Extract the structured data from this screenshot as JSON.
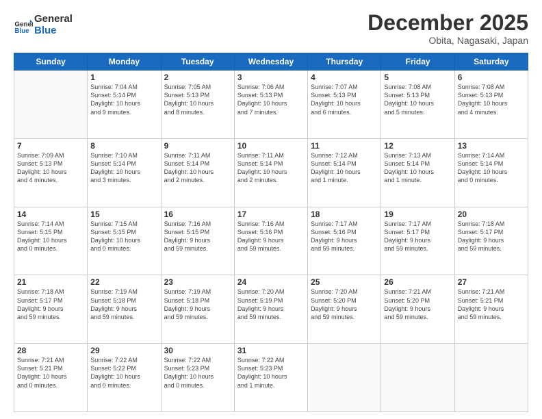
{
  "header": {
    "logo_text_general": "General",
    "logo_text_blue": "Blue",
    "month": "December 2025",
    "location": "Obita, Nagasaki, Japan"
  },
  "days_of_week": [
    "Sunday",
    "Monday",
    "Tuesday",
    "Wednesday",
    "Thursday",
    "Friday",
    "Saturday"
  ],
  "weeks": [
    [
      {
        "day": "",
        "info": ""
      },
      {
        "day": "1",
        "info": "Sunrise: 7:04 AM\nSunset: 5:14 PM\nDaylight: 10 hours\nand 9 minutes."
      },
      {
        "day": "2",
        "info": "Sunrise: 7:05 AM\nSunset: 5:13 PM\nDaylight: 10 hours\nand 8 minutes."
      },
      {
        "day": "3",
        "info": "Sunrise: 7:06 AM\nSunset: 5:13 PM\nDaylight: 10 hours\nand 7 minutes."
      },
      {
        "day": "4",
        "info": "Sunrise: 7:07 AM\nSunset: 5:13 PM\nDaylight: 10 hours\nand 6 minutes."
      },
      {
        "day": "5",
        "info": "Sunrise: 7:08 AM\nSunset: 5:13 PM\nDaylight: 10 hours\nand 5 minutes."
      },
      {
        "day": "6",
        "info": "Sunrise: 7:08 AM\nSunset: 5:13 PM\nDaylight: 10 hours\nand 4 minutes."
      }
    ],
    [
      {
        "day": "7",
        "info": "Sunrise: 7:09 AM\nSunset: 5:13 PM\nDaylight: 10 hours\nand 4 minutes."
      },
      {
        "day": "8",
        "info": "Sunrise: 7:10 AM\nSunset: 5:14 PM\nDaylight: 10 hours\nand 3 minutes."
      },
      {
        "day": "9",
        "info": "Sunrise: 7:11 AM\nSunset: 5:14 PM\nDaylight: 10 hours\nand 2 minutes."
      },
      {
        "day": "10",
        "info": "Sunrise: 7:11 AM\nSunset: 5:14 PM\nDaylight: 10 hours\nand 2 minutes."
      },
      {
        "day": "11",
        "info": "Sunrise: 7:12 AM\nSunset: 5:14 PM\nDaylight: 10 hours\nand 1 minute."
      },
      {
        "day": "12",
        "info": "Sunrise: 7:13 AM\nSunset: 5:14 PM\nDaylight: 10 hours\nand 1 minute."
      },
      {
        "day": "13",
        "info": "Sunrise: 7:14 AM\nSunset: 5:14 PM\nDaylight: 10 hours\nand 0 minutes."
      }
    ],
    [
      {
        "day": "14",
        "info": "Sunrise: 7:14 AM\nSunset: 5:15 PM\nDaylight: 10 hours\nand 0 minutes."
      },
      {
        "day": "15",
        "info": "Sunrise: 7:15 AM\nSunset: 5:15 PM\nDaylight: 10 hours\nand 0 minutes."
      },
      {
        "day": "16",
        "info": "Sunrise: 7:16 AM\nSunset: 5:15 PM\nDaylight: 9 hours\nand 59 minutes."
      },
      {
        "day": "17",
        "info": "Sunrise: 7:16 AM\nSunset: 5:16 PM\nDaylight: 9 hours\nand 59 minutes."
      },
      {
        "day": "18",
        "info": "Sunrise: 7:17 AM\nSunset: 5:16 PM\nDaylight: 9 hours\nand 59 minutes."
      },
      {
        "day": "19",
        "info": "Sunrise: 7:17 AM\nSunset: 5:17 PM\nDaylight: 9 hours\nand 59 minutes."
      },
      {
        "day": "20",
        "info": "Sunrise: 7:18 AM\nSunset: 5:17 PM\nDaylight: 9 hours\nand 59 minutes."
      }
    ],
    [
      {
        "day": "21",
        "info": "Sunrise: 7:18 AM\nSunset: 5:17 PM\nDaylight: 9 hours\nand 59 minutes."
      },
      {
        "day": "22",
        "info": "Sunrise: 7:19 AM\nSunset: 5:18 PM\nDaylight: 9 hours\nand 59 minutes."
      },
      {
        "day": "23",
        "info": "Sunrise: 7:19 AM\nSunset: 5:18 PM\nDaylight: 9 hours\nand 59 minutes."
      },
      {
        "day": "24",
        "info": "Sunrise: 7:20 AM\nSunset: 5:19 PM\nDaylight: 9 hours\nand 59 minutes."
      },
      {
        "day": "25",
        "info": "Sunrise: 7:20 AM\nSunset: 5:20 PM\nDaylight: 9 hours\nand 59 minutes."
      },
      {
        "day": "26",
        "info": "Sunrise: 7:21 AM\nSunset: 5:20 PM\nDaylight: 9 hours\nand 59 minutes."
      },
      {
        "day": "27",
        "info": "Sunrise: 7:21 AM\nSunset: 5:21 PM\nDaylight: 9 hours\nand 59 minutes."
      }
    ],
    [
      {
        "day": "28",
        "info": "Sunrise: 7:21 AM\nSunset: 5:21 PM\nDaylight: 10 hours\nand 0 minutes."
      },
      {
        "day": "29",
        "info": "Sunrise: 7:22 AM\nSunset: 5:22 PM\nDaylight: 10 hours\nand 0 minutes."
      },
      {
        "day": "30",
        "info": "Sunrise: 7:22 AM\nSunset: 5:23 PM\nDaylight: 10 hours\nand 0 minutes."
      },
      {
        "day": "31",
        "info": "Sunrise: 7:22 AM\nSunset: 5:23 PM\nDaylight: 10 hours\nand 1 minute."
      },
      {
        "day": "",
        "info": ""
      },
      {
        "day": "",
        "info": ""
      },
      {
        "day": "",
        "info": ""
      }
    ]
  ]
}
